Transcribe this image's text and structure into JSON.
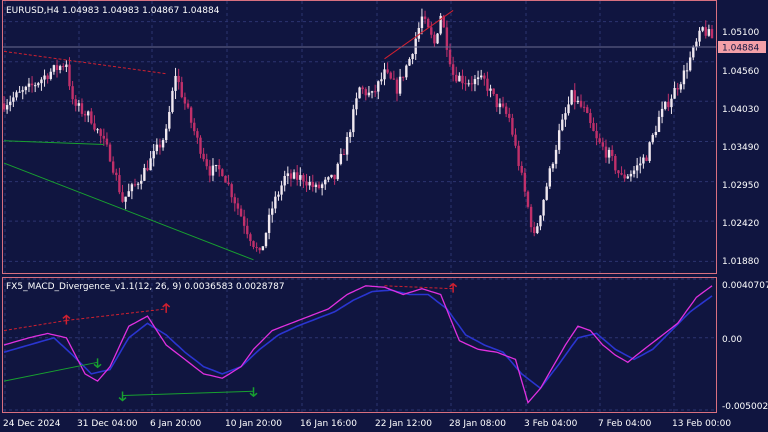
{
  "main_pane": {
    "title": "EURUSD,H4  1.04983 1.04983 1.04867 1.04884",
    "price_labels": [
      "1.05100",
      "1.04560",
      "1.04030",
      "1.03490",
      "1.02950",
      "1.02420",
      "1.01880"
    ],
    "current_price": "1.04884"
  },
  "indicator_pane": {
    "title": "FX5_MACD_Divergence_v1.1(12, 26, 9) 0.0036583 0.0028787",
    "labels": [
      "0.0040707",
      "0.00",
      "-0.0050022"
    ]
  },
  "time_labels": [
    "24 Dec 2024",
    "31 Dec 04:00",
    "6 Jan 20:00",
    "10 Jan 20:00",
    "16 Jan 16:00",
    "22 Jan 12:00",
    "28 Jan 08:00",
    "3 Feb 04:00",
    "7 Feb 04:00",
    "13 Feb 00:00"
  ],
  "colors": {
    "background": "#101540",
    "bull_candle": "#f0e8f0",
    "bear_candle": "#c0306a",
    "macd_line": "#e030e0",
    "signal_line": "#2a35d0",
    "bearish_divergence": "#d02030",
    "bullish_divergence": "#18a030",
    "current_price_tag": "#f4a0a8"
  },
  "chart_data": [
    {
      "type": "candlestick",
      "symbol": "EURUSD",
      "timeframe": "H4",
      "ylim": [
        1.0175,
        1.0535
      ],
      "y_ticks": [
        1.051,
        1.0456,
        1.0403,
        1.0349,
        1.0295,
        1.0242,
        1.0188
      ],
      "current": 1.04884,
      "anchors": [
        [
          0,
          1.04
        ],
        [
          8,
          1.042
        ],
        [
          14,
          1.044
        ],
        [
          20,
          1.0455
        ],
        [
          22,
          1.04
        ],
        [
          28,
          1.038
        ],
        [
          34,
          1.033
        ],
        [
          38,
          1.027
        ],
        [
          42,
          1.029
        ],
        [
          48,
          1.033
        ],
        [
          52,
          1.036
        ],
        [
          55,
          1.044
        ],
        [
          58,
          1.04
        ],
        [
          62,
          1.035
        ],
        [
          66,
          1.031
        ],
        [
          70,
          1.031
        ],
        [
          74,
          1.027
        ],
        [
          78,
          1.023
        ],
        [
          82,
          1.0195
        ],
        [
          86,
          1.026
        ],
        [
          90,
          1.03
        ],
        [
          96,
          1.03
        ],
        [
          100,
          1.0285
        ],
        [
          106,
          1.03
        ],
        [
          110,
          1.035
        ],
        [
          114,
          1.042
        ],
        [
          118,
          1.041
        ],
        [
          122,
          1.044
        ],
        [
          126,
          1.042
        ],
        [
          130,
          1.046
        ],
        [
          134,
          1.0515
        ],
        [
          138,
          1.048
        ],
        [
          140,
          1.052
        ],
        [
          144,
          1.044
        ],
        [
          148,
          1.043
        ],
        [
          154,
          1.043
        ],
        [
          158,
          1.04
        ],
        [
          162,
          1.038
        ],
        [
          166,
          1.03
        ],
        [
          170,
          1.022
        ],
        [
          174,
          1.029
        ],
        [
          178,
          1.036
        ],
        [
          182,
          1.041
        ],
        [
          186,
          1.039
        ],
        [
          190,
          1.035
        ],
        [
          194,
          1.033
        ],
        [
          198,
          1.03
        ],
        [
          202,
          1.031
        ],
        [
          206,
          1.033
        ],
        [
          210,
          1.038
        ],
        [
          214,
          1.041
        ],
        [
          218,
          1.044
        ],
        [
          222,
          1.048
        ],
        [
          224,
          1.05
        ],
        [
          227,
          1.0488
        ]
      ]
    },
    {
      "type": "line",
      "name": "FX5_MACD_Divergence_v1.1",
      "ylim": [
        -0.0050022,
        0.0040707
      ],
      "macd_anchors": [
        [
          0,
          -0.0005
        ],
        [
          8,
          0.0
        ],
        [
          14,
          0.0003
        ],
        [
          20,
          0.0
        ],
        [
          26,
          -0.0025
        ],
        [
          30,
          -0.003
        ],
        [
          34,
          -0.002
        ],
        [
          40,
          0.0008
        ],
        [
          46,
          0.0015
        ],
        [
          52,
          -0.0005
        ],
        [
          58,
          -0.0015
        ],
        [
          64,
          -0.0025
        ],
        [
          70,
          -0.0028
        ],
        [
          76,
          -0.002
        ],
        [
          80,
          -0.0008
        ],
        [
          86,
          0.0005
        ],
        [
          92,
          0.001
        ],
        [
          98,
          0.0015
        ],
        [
          104,
          0.002
        ],
        [
          110,
          0.003
        ],
        [
          116,
          0.0036
        ],
        [
          122,
          0.0035
        ],
        [
          128,
          0.003
        ],
        [
          134,
          0.0034
        ],
        [
          140,
          0.003
        ],
        [
          146,
          -0.0002
        ],
        [
          152,
          -0.0008
        ],
        [
          158,
          -0.001
        ],
        [
          164,
          -0.0015
        ],
        [
          168,
          -0.0045
        ],
        [
          172,
          -0.0035
        ],
        [
          176,
          -0.002
        ],
        [
          180,
          -0.0005
        ],
        [
          184,
          0.0008
        ],
        [
          188,
          0.0005
        ],
        [
          192,
          -0.0005
        ],
        [
          196,
          -0.0012
        ],
        [
          200,
          -0.0017
        ],
        [
          204,
          -0.001
        ],
        [
          210,
          0.0
        ],
        [
          216,
          0.001
        ],
        [
          222,
          0.0028
        ],
        [
          227,
          0.0036
        ]
      ],
      "signal_anchors": [
        [
          0,
          -0.001
        ],
        [
          8,
          -0.0005
        ],
        [
          16,
          0.0
        ],
        [
          22,
          -0.0012
        ],
        [
          28,
          -0.0025
        ],
        [
          34,
          -0.0022
        ],
        [
          40,
          0.0
        ],
        [
          46,
          0.001
        ],
        [
          52,
          0.0002
        ],
        [
          58,
          -0.001
        ],
        [
          64,
          -0.002
        ],
        [
          70,
          -0.0025
        ],
        [
          76,
          -0.002
        ],
        [
          82,
          -0.0008
        ],
        [
          88,
          0.0002
        ],
        [
          94,
          0.0008
        ],
        [
          100,
          0.0013
        ],
        [
          106,
          0.0018
        ],
        [
          112,
          0.0026
        ],
        [
          118,
          0.0032
        ],
        [
          124,
          0.0033
        ],
        [
          130,
          0.003
        ],
        [
          136,
          0.003
        ],
        [
          142,
          0.002
        ],
        [
          148,
          0.0002
        ],
        [
          154,
          -0.0005
        ],
        [
          160,
          -0.001
        ],
        [
          166,
          -0.0025
        ],
        [
          172,
          -0.0035
        ],
        [
          178,
          -0.0018
        ],
        [
          184,
          0.0
        ],
        [
          190,
          0.0003
        ],
        [
          196,
          -0.0008
        ],
        [
          202,
          -0.0015
        ],
        [
          208,
          -0.0008
        ],
        [
          214,
          0.0005
        ],
        [
          220,
          0.0018
        ],
        [
          227,
          0.0029
        ]
      ],
      "divergence_lines": [
        {
          "kind": "bearish",
          "pane": "main",
          "from": [
            0,
            1.047
          ],
          "to": [
            52,
            1.044
          ],
          "dashed": true
        },
        {
          "kind": "bearish",
          "pane": "main",
          "from": [
            122,
            1.046
          ],
          "to": [
            144,
            1.0525
          ],
          "dashed": false
        },
        {
          "kind": "bullish",
          "pane": "main",
          "from": [
            0,
            1.035
          ],
          "to": [
            32,
            1.0345
          ],
          "dashed": false
        },
        {
          "kind": "bullish",
          "pane": "main",
          "from": [
            0,
            1.032
          ],
          "to": [
            80,
            1.019
          ],
          "dashed": false
        },
        {
          "kind": "bearish",
          "pane": "indicator",
          "from": [
            0,
            0.0005
          ],
          "to": [
            20,
            0.0012
          ],
          "dashed": true
        },
        {
          "kind": "bearish",
          "pane": "indicator",
          "from": [
            20,
            0.0012
          ],
          "to": [
            52,
            0.002
          ],
          "dashed": true
        },
        {
          "kind": "bearish",
          "pane": "indicator",
          "from": [
            122,
            0.0036
          ],
          "to": [
            144,
            0.0034
          ],
          "dashed": true
        },
        {
          "kind": "bullish",
          "pane": "indicator",
          "from": [
            0,
            -0.003
          ],
          "to": [
            30,
            -0.0017
          ],
          "dashed": false
        },
        {
          "kind": "bullish",
          "pane": "indicator",
          "from": [
            38,
            -0.004
          ],
          "to": [
            80,
            -0.0037
          ],
          "dashed": false
        }
      ],
      "arrows": [
        {
          "kind": "bearish",
          "x": 20,
          "y": 0.0012
        },
        {
          "kind": "bearish",
          "x": 52,
          "y": 0.002
        },
        {
          "kind": "bearish",
          "x": 144,
          "y": 0.0034
        },
        {
          "kind": "bullish",
          "x": 30,
          "y": -0.0017
        },
        {
          "kind": "bullish",
          "x": 38,
          "y": -0.004
        },
        {
          "kind": "bullish",
          "x": 80,
          "y": -0.0037
        }
      ]
    }
  ]
}
